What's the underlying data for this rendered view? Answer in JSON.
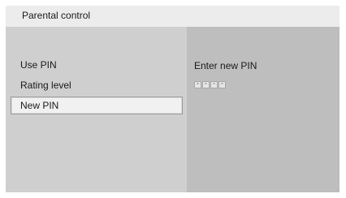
{
  "header": {
    "title": "Parental control"
  },
  "menu": {
    "items": [
      {
        "label": "Use PIN"
      },
      {
        "label": "Rating level"
      },
      {
        "label": "New PIN",
        "selected": true
      }
    ]
  },
  "detail": {
    "label": "Enter new PIN",
    "pin_mask": [
      "*",
      "*",
      "*",
      "*"
    ]
  }
}
